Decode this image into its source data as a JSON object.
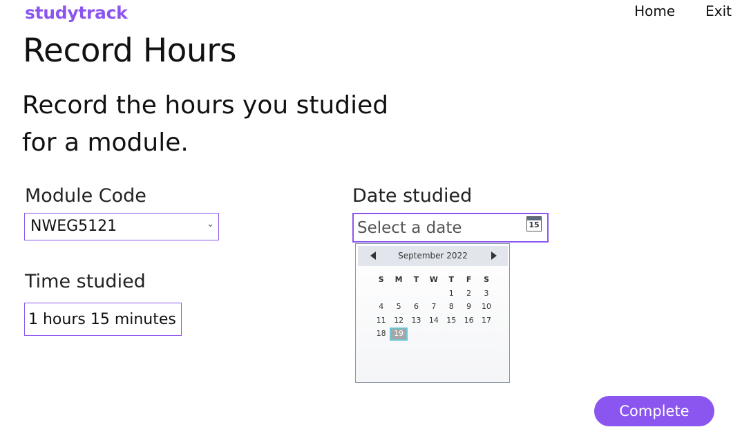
{
  "header": {
    "brand": "studytrack",
    "nav": {
      "home": "Home",
      "exit": "Exit"
    }
  },
  "page": {
    "title": "Record Hours",
    "subtitle": "Record the hours you studied for a module."
  },
  "form": {
    "module_label": "Module Code",
    "module_value": "NWEG5121",
    "time_label": "Time studied",
    "time_value": "1 hours 15 minutes",
    "date_label": "Date studied",
    "date_placeholder": "Select a date",
    "calendar_icon_day": "15"
  },
  "calendar": {
    "month_year": "September 2022",
    "weekdays": [
      "S",
      "M",
      "T",
      "W",
      "T",
      "F",
      "S"
    ],
    "weeks": [
      [
        "",
        "",
        "",
        "",
        "1",
        "2",
        "3"
      ],
      [
        "4",
        "5",
        "6",
        "7",
        "8",
        "9",
        "10"
      ],
      [
        "11",
        "12",
        "13",
        "14",
        "15",
        "16",
        "17"
      ],
      [
        "18",
        "19",
        "",
        "",
        "",
        "",
        ""
      ]
    ],
    "today": "19"
  },
  "actions": {
    "complete_label": "Complete"
  },
  "colors": {
    "accent": "#8b55f0"
  }
}
